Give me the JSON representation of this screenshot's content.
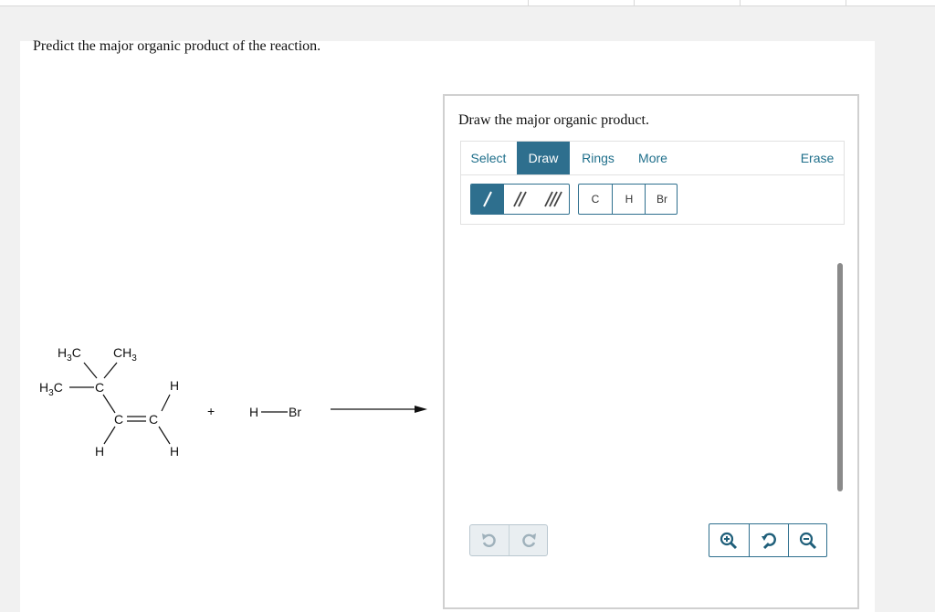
{
  "question": {
    "prompt": "Predict the major organic product of the reaction."
  },
  "reaction": {
    "reactant1": {
      "label_h3c_top": "H",
      "label_h3c_top_sub": "3",
      "label_h3c_top_c": "C",
      "label_ch3": "CH",
      "label_ch3_sub": "3",
      "label_h3c_left": "H",
      "label_h3c_left_sub": "3",
      "label_h3c_left_c": "C",
      "label_c_quat": "C",
      "label_c_left": "C",
      "label_c_right": "C",
      "label_h_top_right": "H",
      "label_h_bottom_left": "H",
      "label_h_bottom_right": "H"
    },
    "plus": "+",
    "reactant2": {
      "label_h": "H",
      "label_br": "Br"
    }
  },
  "editor": {
    "title": "Draw the major organic product.",
    "tabs": [
      {
        "label": "Select"
      },
      {
        "label": "Draw"
      },
      {
        "label": "Rings"
      },
      {
        "label": "More"
      }
    ],
    "erase_label": "Erase",
    "atoms": [
      "C",
      "H",
      "Br"
    ],
    "colors": {
      "accent": "#2e6f8e",
      "tab_text": "#1f6f8b",
      "zoom_icon": "#1f5f7a"
    }
  }
}
